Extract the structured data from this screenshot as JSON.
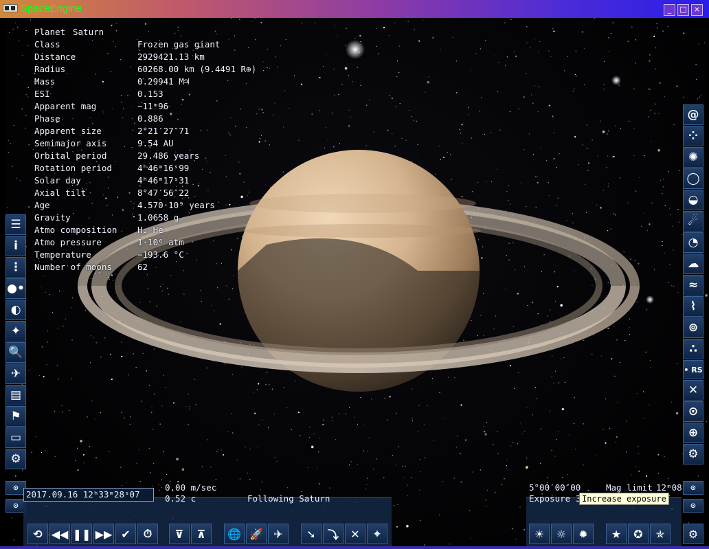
{
  "window": {
    "title": "SpaceEngine",
    "minimize": "_",
    "maximize": "□",
    "close": "×"
  },
  "object_info": {
    "header_label": "Planet",
    "header_name": "Saturn",
    "rows": [
      {
        "label": "Class",
        "value": "Frozen gas giant"
      },
      {
        "label": "Distance",
        "value": "2929421.13 km"
      },
      {
        "label": "Radius",
        "value": "60268.00 km (9.4491 R⊕)"
      },
      {
        "label": "Mass",
        "value": "0.29941 M♃"
      },
      {
        "label": "ESI",
        "value": "0.153"
      },
      {
        "label": "Apparent mag",
        "value": "−11ᵐ96"
      },
      {
        "label": "Phase",
        "value": "0.886"
      },
      {
        "label": "Apparent size",
        "value": "2°21′27″71"
      },
      {
        "label": "Semimajor axis",
        "value": "9.54 AU"
      },
      {
        "label": "Orbital period",
        "value": "29.486 years"
      },
      {
        "label": "Rotation period",
        "value": "4ʰ46ᵐ16ˢ99"
      },
      {
        "label": "Solar day",
        "value": "4ʰ46ᵐ17ˢ31"
      },
      {
        "label": "Axial tilt",
        "value": "8°47′56″22"
      },
      {
        "label": "Age",
        "value": "4.570·10⁹ years"
      },
      {
        "label": "Gravity",
        "value": "1.0658 g"
      },
      {
        "label": "Atmo composition",
        "value": "H₂ He"
      },
      {
        "label": "Atmo pressure",
        "value": "1·10⁶ atm"
      },
      {
        "label": "Temperature",
        "value": "−193.6 °C"
      },
      {
        "label": "Number of moons",
        "value": "62"
      }
    ]
  },
  "left_toolbar": [
    {
      "icon": "menu-icon",
      "glyph": "☰"
    },
    {
      "icon": "info-icon",
      "glyph": "i"
    },
    {
      "icon": "orbit-chart-icon",
      "glyph": "⋮"
    },
    {
      "icon": "planet-system-icon",
      "glyph": "●•"
    },
    {
      "icon": "moons-icon",
      "glyph": "◐"
    },
    {
      "icon": "starmap-icon",
      "glyph": "✦"
    },
    {
      "icon": "search-icon",
      "glyph": "🔍"
    },
    {
      "icon": "spaceship-icon",
      "glyph": "✈"
    },
    {
      "icon": "notepad-icon",
      "glyph": "▤"
    },
    {
      "icon": "locations-flag-icon",
      "glyph": "⚑"
    },
    {
      "icon": "display-settings-icon",
      "glyph": "▭"
    },
    {
      "icon": "settings-gear-icon",
      "glyph": "⚙"
    }
  ],
  "right_toolbar": [
    {
      "icon": "galaxies-icon",
      "glyph": "@"
    },
    {
      "icon": "star-clusters-icon",
      "glyph": "⁘"
    },
    {
      "icon": "globular-clusters-icon",
      "glyph": "✺"
    },
    {
      "icon": "nebulae-icon",
      "glyph": "◯"
    },
    {
      "icon": "planets-icon",
      "glyph": "◒"
    },
    {
      "icon": "comets-icon",
      "glyph": "☄"
    },
    {
      "icon": "moons-icon",
      "glyph": "◔"
    },
    {
      "icon": "clouds-icon",
      "glyph": "☁"
    },
    {
      "icon": "water-waves-icon",
      "glyph": "≈"
    },
    {
      "icon": "aurora-icon",
      "glyph": "⌇"
    },
    {
      "icon": "ring-orbits-icon",
      "glyph": "⊚"
    },
    {
      "icon": "asteroids-icon",
      "glyph": "∴"
    },
    {
      "icon": "labels-icon",
      "glyph": "• RS"
    },
    {
      "icon": "markers-icon",
      "glyph": "✕"
    },
    {
      "icon": "orbits-icon",
      "glyph": "⊙"
    },
    {
      "icon": "grid-icon",
      "glyph": "⊕"
    },
    {
      "icon": "settings-gear-icon",
      "glyph": "⚙"
    }
  ],
  "time_panel": {
    "date_time": "2017.09.16  12ʰ33ᵐ28ˢ07",
    "speed": "0.00  m/sec",
    "speed_c": "0.52  c",
    "following": "Following  Saturn"
  },
  "exposure_panel": {
    "fov": "5°00′00″00",
    "mag_limit_label": "Mag limit",
    "mag_limit": "12ᵐ08",
    "exposure_label": "Exposure",
    "exposure_value": "3",
    "tooltip": "Increase exposure"
  },
  "colors": {
    "title_text": "#1aff1a",
    "panel": "#14284a",
    "tooltip_bg": "#ffffd8"
  }
}
